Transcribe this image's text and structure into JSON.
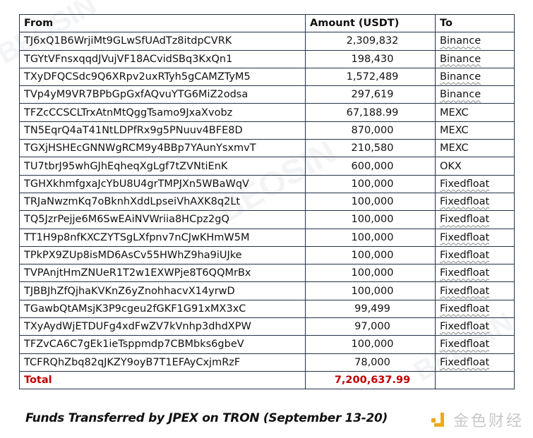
{
  "table": {
    "headers": {
      "from": "From",
      "amount": "Amount (USDT)",
      "to": "To"
    },
    "rows": [
      {
        "from": "TJ6xQ1B6WrjiMt9GLwSfUAdTz8itdpCVRK",
        "amount": "2,309,832",
        "to": "Binance"
      },
      {
        "from": "TGYtVFnsxqqdJVujVF18ACvidSBq3KxQn1",
        "amount": "198,430",
        "to": "Binance"
      },
      {
        "from": "TXyDFQCSdc9Q6XRpv2uxRTyh5gCAMZTyM5",
        "amount": "1,572,489",
        "to": "Binance"
      },
      {
        "from": "TVp4yM9VR7BPbGpGxfAQvuYTG6MiZ2odsa",
        "amount": "297,619",
        "to": "Binance"
      },
      {
        "from": "TFZcCCSCLTrxAtnMtQggTsamo9JxaXvobz",
        "amount": "67,188.99",
        "to": "MEXC"
      },
      {
        "from": "TN5EqrQ4aT41NtLDPfRx9g5PNuuv4BFE8D",
        "amount": "870,000",
        "to": "MEXC"
      },
      {
        "from": "TGXjHSHEcGNNWgRCM9y4BBp7YAunYsxmvT",
        "amount": "210,580",
        "to": "MEXC"
      },
      {
        "from": "TU7tbrJ95whGJhEqheqXgLgf7tZVNtiEnK",
        "amount": "600,000",
        "to": "OKX"
      },
      {
        "from": "TGHXkhmfgxaJcYbU8U4grTMPJXn5WBaWqV",
        "amount": "100,000",
        "to": "Fixedfloat"
      },
      {
        "from": "TRJaNwzmKq7oBknhXddLpseiVhAXK8q2Lt",
        "amount": "100,000",
        "to": "Fixedfloat"
      },
      {
        "from": "TQ5JzrPejje6M6SwEAiNVWriia8HCpz2gQ",
        "amount": "100,000",
        "to": "Fixedfloat"
      },
      {
        "from": "TT1H9p8nfKXCZYTSgLXfpnv7nCJwKHmW5M",
        "amount": "100,000",
        "to": "Fixedfloat"
      },
      {
        "from": "TPkPX9ZUp8isMD6AsCv55HWhZ9ha9iUJke",
        "amount": "100,000",
        "to": "Fixedfloat"
      },
      {
        "from": "TVPAnjtHmZNUeR1T2w1EXWPje8T6QQMrBx",
        "amount": "100,000",
        "to": "Fixedfloat"
      },
      {
        "from": "TJBBJhZfQjhaKVKnZ6yZnohhacvX14yrwD",
        "amount": "100,000",
        "to": "Fixedfloat"
      },
      {
        "from": "TGawbQtAMsjK3P9cgeu2fGKF1G91xMX3xC",
        "amount": "99,499",
        "to": "Fixedfloat"
      },
      {
        "from": "TXyAydWjETDUFg4xdFwZV7kVnhp3dhdXPW",
        "amount": "97,000",
        "to": "Fixedfloat"
      },
      {
        "from": "TFZvCA6C7gEk1ieTsppmdp7CBMbks6gbeV",
        "amount": "100,000",
        "to": "Fixedfloat"
      },
      {
        "from": "TCFRQhZbq82qJKZY9oyB7T1EFAyCxjmRzF",
        "amount": "78,000",
        "to": "Fixedfloat"
      }
    ],
    "total": {
      "label": "Total",
      "amount": "7,200,637.99",
      "to": ""
    }
  },
  "caption": "Funds Transferred by JPEX on TRON (September 13-20)",
  "logo": {
    "text": "金色财经",
    "icon": "jinse-logo-icon"
  },
  "colors": {
    "total_text": "#c00000",
    "border": "#253348",
    "logo_accent": "#f0a81c"
  }
}
